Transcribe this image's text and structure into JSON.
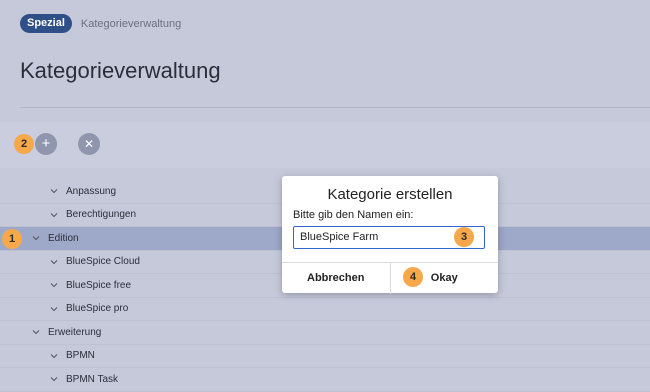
{
  "breadcrumb": {
    "namespace": "Spezial",
    "page": "Kategorieverwaltung"
  },
  "page": {
    "title": "Kategorieverwaltung"
  },
  "toolbar": {
    "add_icon": "plus-icon",
    "remove_icon": "close-icon"
  },
  "tree": {
    "items": [
      {
        "label": "Anpassung",
        "level": 1
      },
      {
        "label": "Berechtigungen",
        "level": 1
      },
      {
        "label": "Edition",
        "level": 0,
        "selected": true
      },
      {
        "label": "BlueSpice Cloud",
        "level": 1
      },
      {
        "label": "BlueSpice free",
        "level": 1
      },
      {
        "label": "BlueSpice pro",
        "level": 1
      },
      {
        "label": "Erweiterung",
        "level": 0
      },
      {
        "label": "BPMN",
        "level": 1
      },
      {
        "label": "BPMN Task",
        "level": 1
      }
    ]
  },
  "dialog": {
    "title": "Kategorie erstellen",
    "prompt": "Bitte gib den Namen ein:",
    "input_value": "BlueSpice Farm",
    "cancel_label": "Abbrechen",
    "ok_label": "Okay"
  },
  "callouts": {
    "one": "1",
    "two": "2",
    "three": "3",
    "four": "4"
  },
  "colors": {
    "accent": "#2e4f88",
    "callout": "#f6a84a",
    "selected_row": "#9ea8c8"
  }
}
